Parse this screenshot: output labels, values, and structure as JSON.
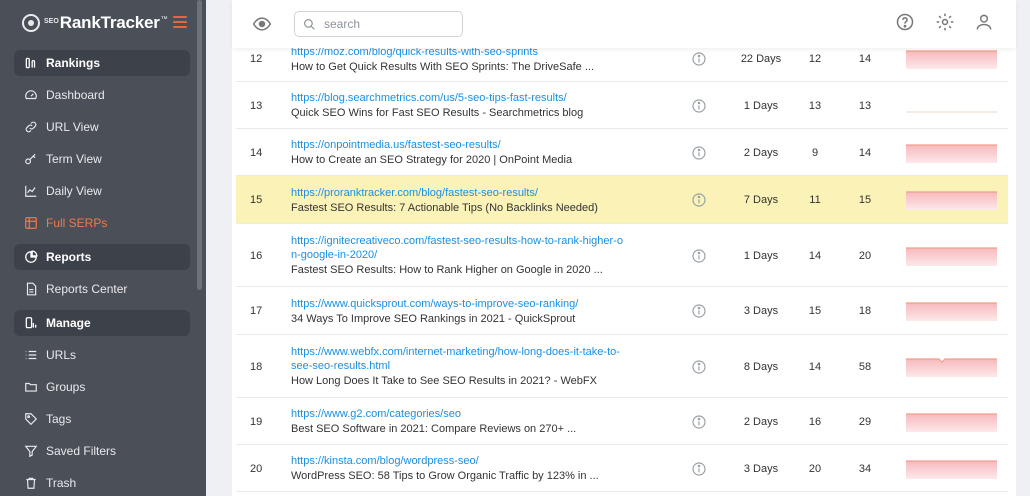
{
  "brand": {
    "prefix": "SEO",
    "name": "RankTracker",
    "tm": "™"
  },
  "sidebar": {
    "items": [
      {
        "label": "Rankings",
        "icon": "rankings-icon",
        "section": true,
        "active": false
      },
      {
        "label": "Dashboard",
        "icon": "gauge-icon",
        "section": false,
        "active": false
      },
      {
        "label": "URL View",
        "icon": "link-icon",
        "section": false,
        "active": false
      },
      {
        "label": "Term View",
        "icon": "key-icon",
        "section": false,
        "active": false
      },
      {
        "label": "Daily View",
        "icon": "line-chart-icon",
        "section": false,
        "active": false
      },
      {
        "label": "Full SERPs",
        "icon": "grid-icon",
        "section": false,
        "active": true
      },
      {
        "label": "Reports",
        "icon": "pie-chart-icon",
        "section": true,
        "active": false
      },
      {
        "label": "Reports Center",
        "icon": "document-icon",
        "section": false,
        "active": false
      },
      {
        "label": "Manage",
        "icon": "manage-icon",
        "section": true,
        "active": false
      },
      {
        "label": "URLs",
        "icon": "list-icon",
        "section": false,
        "active": false
      },
      {
        "label": "Groups",
        "icon": "folder-icon",
        "section": false,
        "active": false
      },
      {
        "label": "Tags",
        "icon": "tag-icon",
        "section": false,
        "active": false
      },
      {
        "label": "Saved Filters",
        "icon": "filter-icon",
        "section": false,
        "active": false
      },
      {
        "label": "Trash",
        "icon": "trash-icon",
        "section": false,
        "active": false
      }
    ]
  },
  "toolbar": {
    "search_placeholder": "search"
  },
  "colors": {
    "accent": "#e8673a",
    "link": "#1a8fe3",
    "highlight": "#fbf2b8",
    "sidebar": "#4a4f58"
  },
  "rows": [
    {
      "rank": "12",
      "url": [
        "https://moz.com/blog/quick-results-with-seo-sprints"
      ],
      "title": "How to Get Quick Results With SEO Sprints: The DriveSafe ...",
      "days": "22 Days",
      "c1": "12",
      "c2": "14",
      "highlight": false,
      "spark": true
    },
    {
      "rank": "13",
      "url": [
        "https://blog.searchmetrics.com/us/5-seo-tips-fast-results/"
      ],
      "title": "Quick SEO Wins for Fast SEO Results - Searchmetrics blog",
      "days": "1 Days",
      "c1": "13",
      "c2": "13",
      "highlight": false,
      "spark": false
    },
    {
      "rank": "14",
      "url": [
        "https://onpointmedia.us/fastest-seo-results/"
      ],
      "title": "How to Create an SEO Strategy for 2020 | OnPoint Media",
      "days": "2 Days",
      "c1": "9",
      "c2": "14",
      "highlight": false,
      "spark": true
    },
    {
      "rank": "15",
      "url": [
        "https://proranktracker.com/blog/fastest-seo-results/"
      ],
      "title": "Fastest SEO Results: 7 Actionable Tips (No Backlinks Needed)",
      "days": "7 Days",
      "c1": "11",
      "c2": "15",
      "highlight": true,
      "spark": true
    },
    {
      "rank": "16",
      "url": [
        "https://ignitecreativeco.com/fastest-seo-results-how-to-rank-higher-o",
        "n-google-in-2020/"
      ],
      "title": "Fastest SEO Results: How to Rank Higher on Google in 2020 ...",
      "days": "1 Days",
      "c1": "14",
      "c2": "20",
      "highlight": false,
      "spark": true
    },
    {
      "rank": "17",
      "url": [
        "https://www.quicksprout.com/ways-to-improve-seo-ranking/"
      ],
      "title": "34 Ways To Improve SEO Rankings in 2021 - QuickSprout",
      "days": "3 Days",
      "c1": "15",
      "c2": "18",
      "highlight": false,
      "spark": true
    },
    {
      "rank": "18",
      "url": [
        "https://www.webfx.com/internet-marketing/how-long-does-it-take-to-",
        "see-seo-results.html"
      ],
      "title": "How Long Does It Take to See SEO Results in 2021? - WebFX",
      "days": "8 Days",
      "c1": "14",
      "c2": "58",
      "highlight": false,
      "spark": true
    },
    {
      "rank": "19",
      "url": [
        "https://www.g2.com/categories/seo"
      ],
      "title": "Best SEO Software in 2021: Compare Reviews on 270+ ...",
      "days": "2 Days",
      "c1": "16",
      "c2": "29",
      "highlight": false,
      "spark": true
    },
    {
      "rank": "20",
      "url": [
        "https://kinsta.com/blog/wordpress-seo/"
      ],
      "title": "WordPress SEO: 58 Tips to Grow Organic Traffic by 123% in ...",
      "days": "3 Days",
      "c1": "20",
      "c2": "34",
      "highlight": false,
      "spark": true
    }
  ]
}
